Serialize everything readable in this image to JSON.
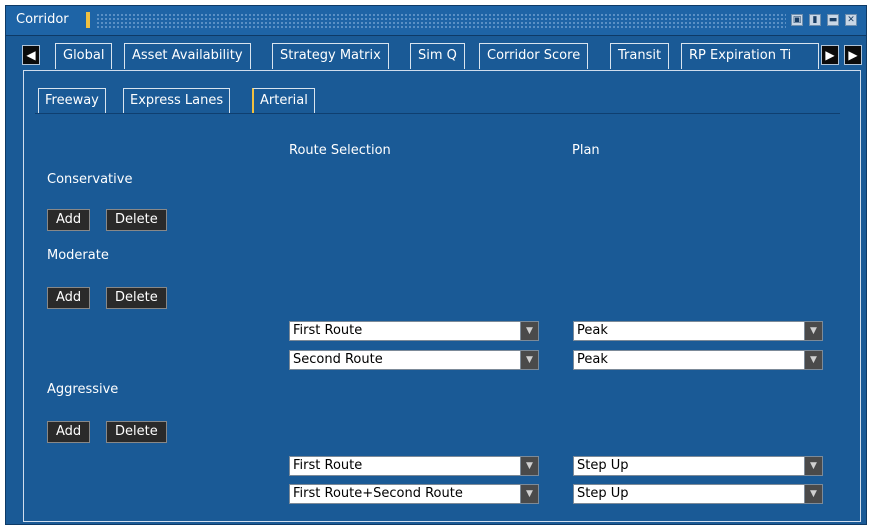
{
  "window": {
    "title": "Corridor",
    "controls": [
      "restore-icon",
      "pin-icon",
      "minimize-icon",
      "close-icon"
    ]
  },
  "outer_tabs": {
    "scroll_left_icon": "circle-arrow-left-icon",
    "scroll_right_icon": "circle-arrow-right-icon",
    "overflow_icon": "circle-arrow-right-icon",
    "items": [
      "Global",
      "Asset Availability",
      "Strategy Matrix",
      "Sim Q",
      "Corridor Score",
      "Transit",
      "RP Expiration Ti"
    ]
  },
  "inner_tabs": {
    "items": [
      "Freeway",
      "Express Lanes",
      "Arterial"
    ],
    "active": "Arterial"
  },
  "columns": {
    "route_selection": "Route Selection",
    "plan": "Plan"
  },
  "sections": [
    {
      "name": "Conservative",
      "add_label": "Add",
      "delete_label": "Delete",
      "rows": []
    },
    {
      "name": "Moderate",
      "add_label": "Add",
      "delete_label": "Delete",
      "rows": [
        {
          "route": "First Route",
          "plan": "Peak"
        },
        {
          "route": "Second Route",
          "plan": "Peak"
        }
      ]
    },
    {
      "name": "Aggressive",
      "add_label": "Add",
      "delete_label": "Delete",
      "rows": [
        {
          "route": "First Route",
          "plan": "Step Up"
        },
        {
          "route": "First Route+Second Route",
          "plan": "Step Up"
        }
      ]
    }
  ],
  "colors": {
    "panel_blue": "#1a5a96",
    "button_dark": "#2a2a2a",
    "active_tab_accent": "#f0c040"
  }
}
